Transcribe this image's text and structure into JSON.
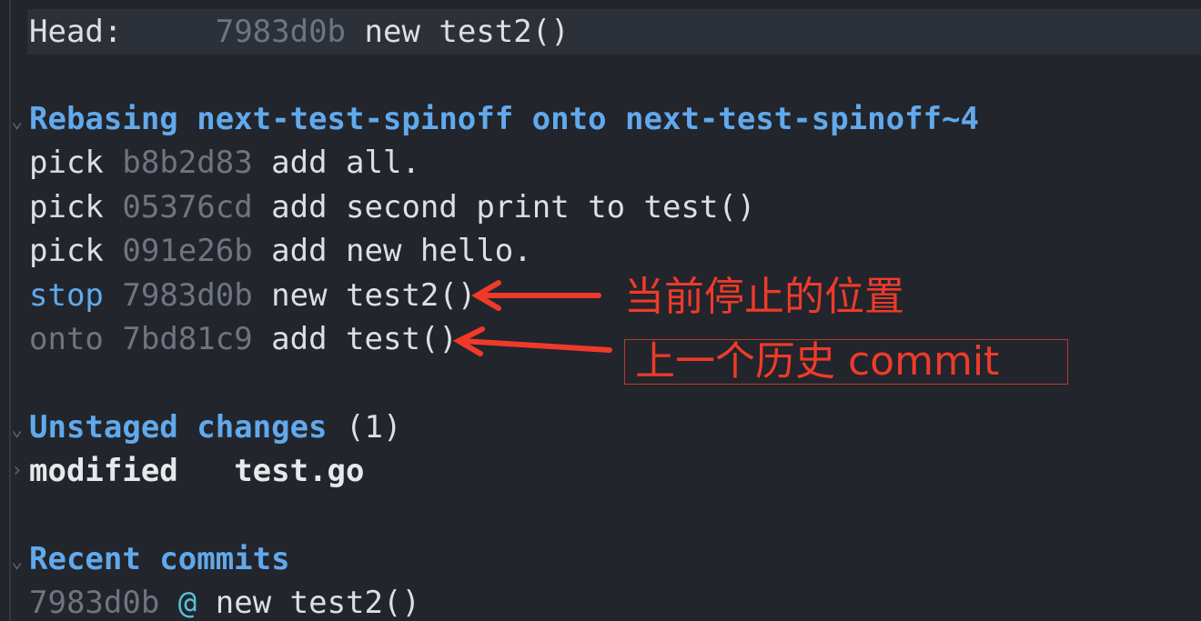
{
  "head": {
    "label": "Head:",
    "hash": "7983d0b",
    "message": "new test2()"
  },
  "rebase": {
    "heading": "Rebasing next-test-spinoff onto next-test-spinoff~4",
    "entries": [
      {
        "action": "pick",
        "hash": "b8b2d83",
        "message": "add all."
      },
      {
        "action": "pick",
        "hash": "05376cd",
        "message": "add second print to test()"
      },
      {
        "action": "pick",
        "hash": "091e26b",
        "message": "add new hello."
      },
      {
        "action": "stop",
        "hash": "7983d0b",
        "message": "new test2()"
      },
      {
        "action": "onto",
        "hash": "7bd81c9",
        "message": "add test()"
      }
    ]
  },
  "unstaged": {
    "heading": "Unstaged changes",
    "count": "(1)",
    "files": [
      {
        "status": "modified",
        "file": "test.go"
      }
    ]
  },
  "recent": {
    "heading": "Recent commits",
    "commits": [
      {
        "hash": "7983d0b",
        "marker": "@",
        "message": "new test2()"
      }
    ]
  },
  "annotations": {
    "stop_note": "当前停止的位置",
    "onto_note": "上一个历史 commit"
  },
  "icons": {
    "section_expanded": "chevron-down-icon",
    "section_collapsed": "chevron-right-icon"
  },
  "colors": {
    "background": "#22252c",
    "heading": "#61a9ec",
    "hash": "#6f7580",
    "annotation": "#ef3a2a"
  }
}
